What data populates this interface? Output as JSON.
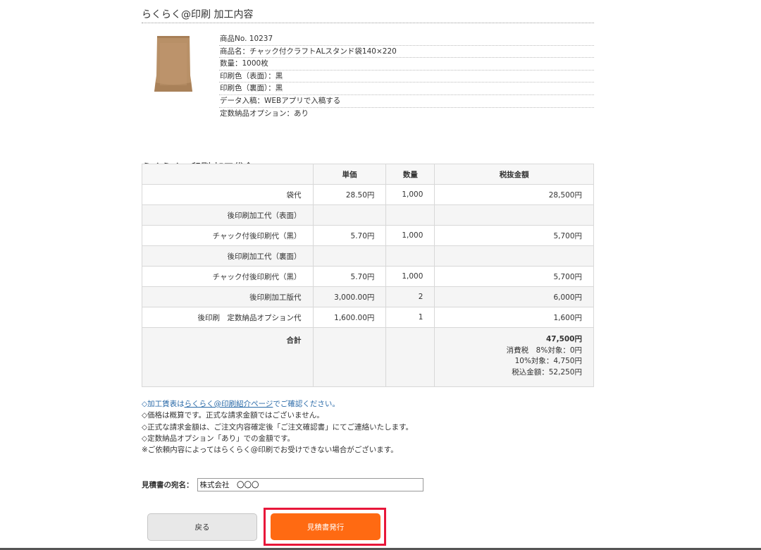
{
  "section1": {
    "title": "らくらく@印刷 加工内容",
    "details": [
      "商品No.  10237",
      "商品名：チャック付クラフトALスタンド袋140×220",
      "数量：1000枚",
      "印刷色（表面）：黒",
      "印刷色（裏面）：黒",
      "データ入稿：WEBアプリで入稿する",
      "定数納品オプション：あり"
    ]
  },
  "section2": {
    "title": "らくらく@印刷 加工代金"
  },
  "table": {
    "headers": [
      "",
      "単価",
      "数量",
      "税抜金額"
    ],
    "rows": [
      [
        "袋代",
        "28.50円",
        "1,000",
        "28,500円"
      ],
      [
        "後印刷加工代（表面）",
        "",
        "",
        ""
      ],
      [
        "チャック付後印刷代（黒）",
        "5.70円",
        "1,000",
        "5,700円"
      ],
      [
        "後印刷加工代（裏面）",
        "",
        "",
        ""
      ],
      [
        "チャック付後印刷代（黒）",
        "5.70円",
        "1,000",
        "5,700円"
      ],
      [
        "後印刷加工版代",
        "3,000.00円",
        "2",
        "6,000円"
      ],
      [
        "後印刷　定数納品オプション代",
        "1,600.00円",
        "1",
        "1,600円"
      ]
    ],
    "total": {
      "label": "合計",
      "amount": "47,500円",
      "tax8": "消費税　8%対象：0円",
      "tax10": "10%対象：4,750円",
      "with_tax": "税込金額：52,250円"
    }
  },
  "notes": {
    "note1_prefix": "◇加工賃表は",
    "note1_link": "らくらく@印刷紹介ページ",
    "note1_suffix": "でご確認ください。",
    "note2": "◇価格は概算です。正式な請求金額ではございません。",
    "note3": "◇正式な請求金額は、ご注文内容確定後「ご注文確認書」にてご連絡いたします。",
    "note4": "◇定数納品オプション「あり」での金額です。",
    "note5": "※ご依頼内容によってはらくらく@印刷でお受けできない場合がございます。"
  },
  "addressee": {
    "label": "見積書の宛名：",
    "value": "株式会社　〇〇〇"
  },
  "buttons": {
    "back": "戻る",
    "issue": "見積書発行"
  },
  "colors": {
    "issue_button": "#ff6a12",
    "highlight_border": "#e8173a",
    "link": "#2a6aa8"
  }
}
